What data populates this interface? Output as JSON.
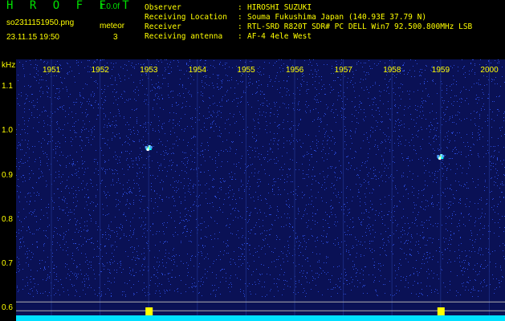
{
  "header": {
    "brand": "H R O F F T",
    "version": "1.0.0f",
    "filename": "so2311151950.png",
    "datetime": "23.11.15 19:50",
    "meteor_label": "meteor",
    "meteor_count": "3",
    "info": [
      {
        "label": "Observer",
        "value": "HIROSHI SUZUKI"
      },
      {
        "label": "Receiving Location",
        "value": "Souma Fukushima Japan (140.93E 37.79 N)"
      },
      {
        "label": "Receiver",
        "value": "RTL-SRD R820T SDR# PC DELL Win7 92.500.800MHz LSB"
      },
      {
        "label": "Receiving antenna",
        "value": "AF-4 4ele West"
      }
    ],
    "colon": ":"
  },
  "chart_data": {
    "type": "heatmap",
    "ylabel": "kHz",
    "y_ticks": [
      "1.1",
      "1.0",
      "0.9",
      "0.8",
      "0.7",
      "0.6"
    ],
    "x_ticks": [
      "1951",
      "1952",
      "1953",
      "1954",
      "1955",
      "1956",
      "1957",
      "1958",
      "1959",
      "2000"
    ],
    "ylim": [
      0.57,
      1.16
    ],
    "xlim": [
      "19:50",
      "20:00"
    ],
    "events": [
      {
        "time": "19:53",
        "freq_khz": 0.96
      },
      {
        "time": "19:59",
        "freq_khz": 0.94
      }
    ],
    "colors": {
      "background": "#0a1155",
      "noise": "#2a4ad8",
      "signal": "#ffff00",
      "baseline": "#00e0ff",
      "reference_lines": "#b0b0b0"
    }
  }
}
